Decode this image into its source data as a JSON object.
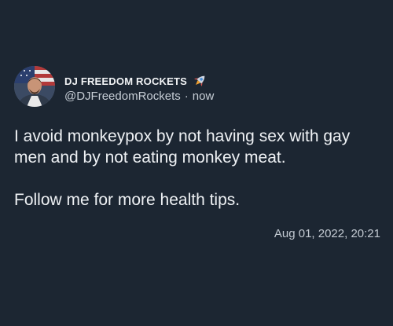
{
  "tweet": {
    "display_name": "DJ FREEDOM ROCKETS",
    "badge_icon": "rocket-icon",
    "handle": "@DJFreedomRockets",
    "separator": "·",
    "relative_time": "now",
    "body_lines": [
      "I avoid monkeypox by not having sex with gay men and by not eating monkey meat.",
      "Follow me for more health tips."
    ],
    "timestamp": "Aug 01, 2022, 20:21"
  },
  "colors": {
    "background": "#1c2632",
    "primary_text": "#eef1f4",
    "secondary_text": "#c3cad2"
  }
}
